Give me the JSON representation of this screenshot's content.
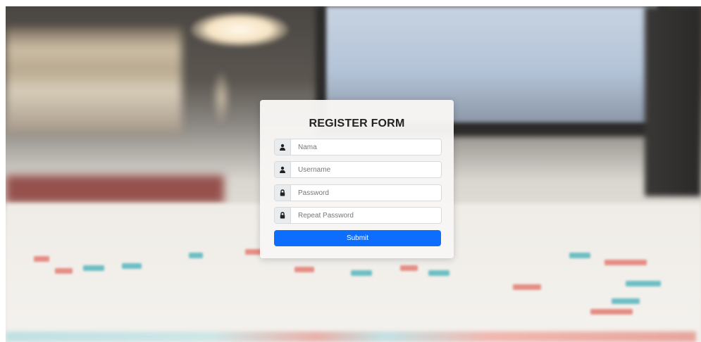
{
  "form": {
    "title": "REGISTER FORM",
    "fields": [
      {
        "placeholder": "Nama",
        "icon": "user-icon"
      },
      {
        "placeholder": "Username",
        "icon": "user-icon"
      },
      {
        "placeholder": "Password",
        "icon": "lock-icon"
      },
      {
        "placeholder": "Repeat Password",
        "icon": "lock-icon"
      }
    ],
    "submit_label": "Submit"
  },
  "colors": {
    "primary": "#0d6efd",
    "card": "#f8f6f4",
    "addon": "#e9ecef"
  }
}
